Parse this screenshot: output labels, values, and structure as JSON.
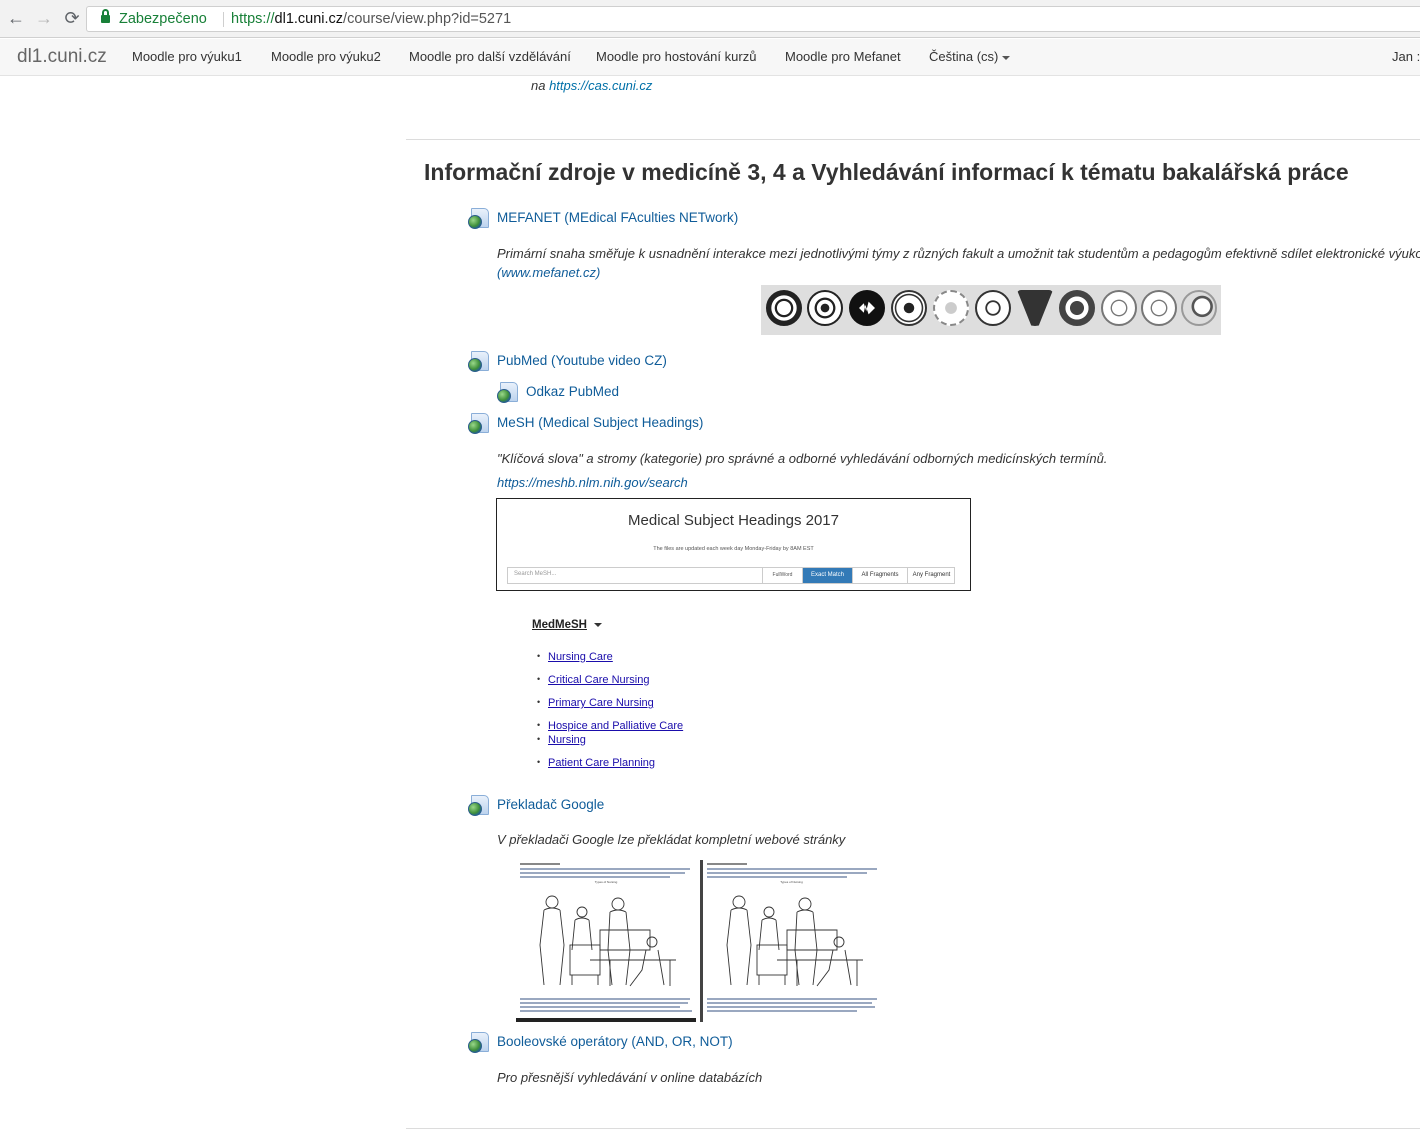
{
  "browser": {
    "secure_label": "Zabezpečeno",
    "url_scheme": "https://",
    "url_host": "dl1.cuni.cz",
    "url_path": "/course/view.php?id=5271"
  },
  "navbar": {
    "brand": "dl1.cuni.cz",
    "items": [
      "Moodle pro výuku1",
      "Moodle pro výuku2",
      "Moodle pro další vzdělávání",
      "Moodle pro hostování kurzů",
      "Moodle pro Mefanet",
      "Čeština (cs)"
    ],
    "user": "Jan :"
  },
  "top_line": {
    "prefix": "na ",
    "link": "https://cas.cuni.cz"
  },
  "section": {
    "title": "Informační zdroje v medicíně 3, 4 a Vyhledávání informací k tématu bakalářská práce"
  },
  "activities": {
    "mefanet": {
      "label": "MEFANET (MEdical FAculties NETwork)",
      "desc": "Primární snaha směřuje k usnadnění interakce mezi jednotlivými týmy z různých fakult a umožnit tak studentům a pedagogům efektivně sdílet elektronické výukové",
      "desc_link": "(www.mefanet.cz)"
    },
    "pubmed": {
      "label": "PubMed (Youtube video CZ)"
    },
    "pubmed_link": {
      "label": "Odkaz PubMed"
    },
    "mesh": {
      "label": "MeSH (Medical Subject Headings)",
      "desc": "\"Klíčová slova\" a stromy (kategorie) pro správné a odborné vyhledávání odborných medicínských termínů.",
      "desc_link": "https://meshb.nlm.nih.gov/search"
    },
    "google": {
      "label": "Překladač Google",
      "desc": "V překladači Google lze překládat kompletní webové stránky"
    },
    "boolean": {
      "label": "Booleovské operátory (AND, OR, NOT)",
      "desc": "Pro přesnější vyhledávání v online databázích"
    }
  },
  "mesh_box": {
    "title": "Medical Subject Headings 2017",
    "note": "The files are updated each week day Monday-Friday by 8AM EST",
    "search_placeholder": "Search MeSH...",
    "select": "FullWord",
    "btn_exact": "Exact Match",
    "btn_all": "All Fragments",
    "btn_any": "Any Fragment"
  },
  "medmesh": {
    "title": "MedMeSH",
    "items": [
      "Nursing Care",
      "Critical Care Nursing",
      "Primary Care Nursing",
      "Hospice and Palliative Care",
      "Nursing",
      "Patient Care Planning"
    ]
  },
  "translate_shot": {
    "left_caption": "Types of Nursing",
    "right_caption": "Types of Nursing"
  },
  "colors": {
    "link": "#0f5c99",
    "secure_green": "#188038",
    "mesh_button": "#337ab7"
  }
}
